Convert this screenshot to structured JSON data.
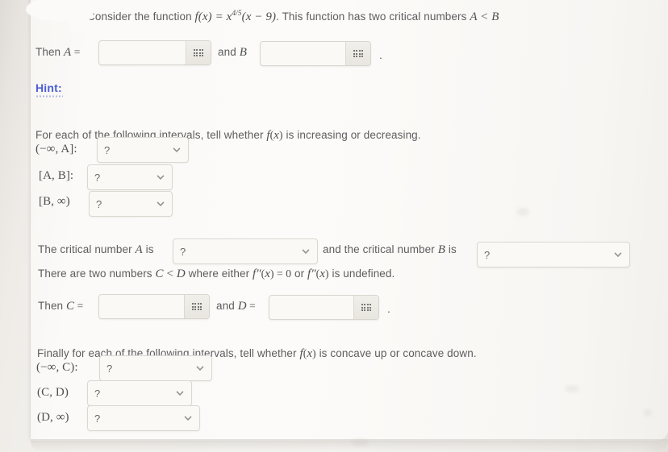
{
  "problem": {
    "intro_prefix": "Consider the function ",
    "intro_fx": "f(x) = x",
    "intro_exponent": "4/5",
    "intro_mid": "(x − 9)",
    "intro_suffix": ". This function has two critical numbers ",
    "intro_ab": "A < B",
    "then_a_label": "Then A =",
    "and_b_label": "and B",
    "period_1": ".",
    "hint_label": "Hint:",
    "increasing_question": "For each of the following intervals, tell whether f(x) is increasing or decreasing.",
    "interval_labels_first": [
      "(−∞, A]:",
      "[A, B]:",
      "[B, ∞)"
    ],
    "critical_a_prefix": "The critical number A is",
    "critical_b_prefix": "and the critical number B is",
    "cd_sentence": "There are two numbers C < D where either f″(x) = 0 or f″(x) is undefined.",
    "then_c_label": "Then C =",
    "and_d_label": "and D =",
    "period_2": ".",
    "concavity_question": "Finally for each of the following intervals, tell whether f(x) is concave up or concave down.",
    "interval_labels_second": [
      "(−∞, C):",
      "(C, D)",
      "(D, ∞)"
    ]
  },
  "inputs": {
    "a_value": "",
    "a_placeholder": "",
    "b_value": "",
    "b_placeholder": "",
    "c_value": "",
    "c_placeholder": "",
    "d_value": "",
    "d_placeholder": ""
  },
  "dropdowns": {
    "unanswered_value": "?",
    "interval_neg_inf_a": "?",
    "interval_a_b": "?",
    "interval_b_inf": "?",
    "critical_a": "?",
    "critical_b": "?",
    "interval_neg_inf_c": "?",
    "interval_c_d": "?",
    "interval_d_inf": "?"
  },
  "icons": {
    "grid_icon": "calculator-grid-icon",
    "chevron_icon": "chevron-down-icon"
  },
  "colors": {
    "page_background": "#e8e6e2",
    "card_background": "#fbfaf8",
    "text": "#5d5d5f",
    "hint_link": "#4c5fd7",
    "field_border": "#d9d6d0",
    "field_background": "#faf9f6"
  }
}
